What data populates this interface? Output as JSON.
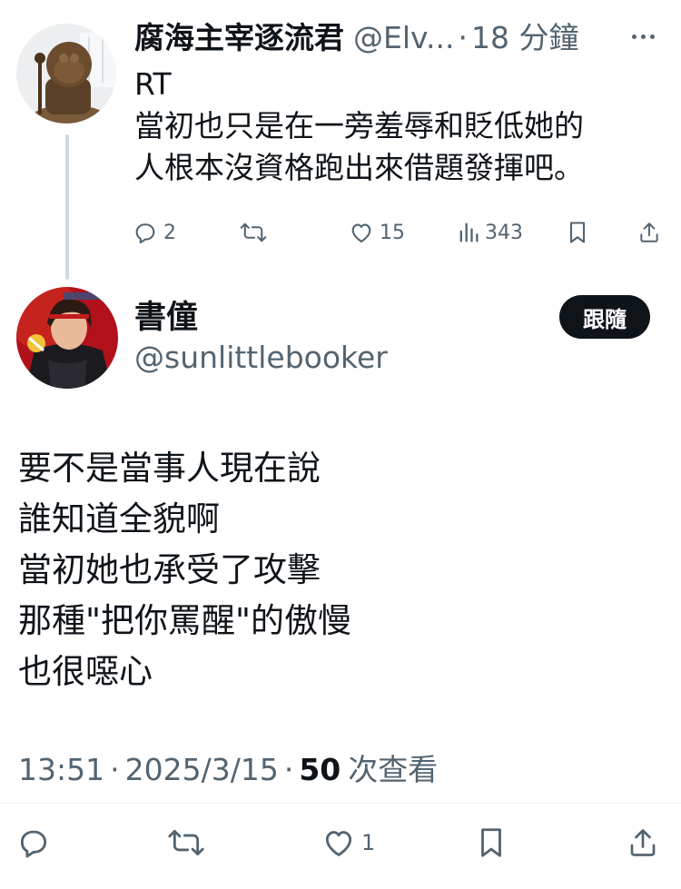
{
  "reply": {
    "display_name": "腐海主宰逐流君",
    "handle": "@Elv...",
    "separator": "·",
    "time": "18 分鐘",
    "text_lines": [
      "RT",
      "當初也只是在一旁羞辱和貶低她的",
      "人根本沒資格跑出來借題發揮吧。"
    ],
    "actions": {
      "replies": "2",
      "reposts": "",
      "likes": "15",
      "views": "343"
    }
  },
  "main_tweet": {
    "display_name": "書僮",
    "handle": "@sunlittlebooker",
    "follow_label": "跟隨",
    "text_lines": [
      "要不是當事人現在說",
      "誰知道全貌啊",
      "當初她也承受了攻擊",
      "那種\"把你罵醒\"的傲慢",
      "也很噁心"
    ],
    "time": "13:51",
    "separator": "·",
    "date": "2025/3/15",
    "views_count": "50",
    "views_label": "次查看",
    "actions": {
      "likes": "1"
    }
  },
  "icons": [
    "reply-icon",
    "repost-icon",
    "like-icon",
    "views-icon",
    "bookmark-icon",
    "share-icon",
    "more-icon"
  ],
  "colors": {
    "text": "#0f1419",
    "secondary": "#536471",
    "thread_line": "#cfd9de",
    "follow_button_bg": "#0f1419",
    "follow_button_text": "#ffffff"
  }
}
